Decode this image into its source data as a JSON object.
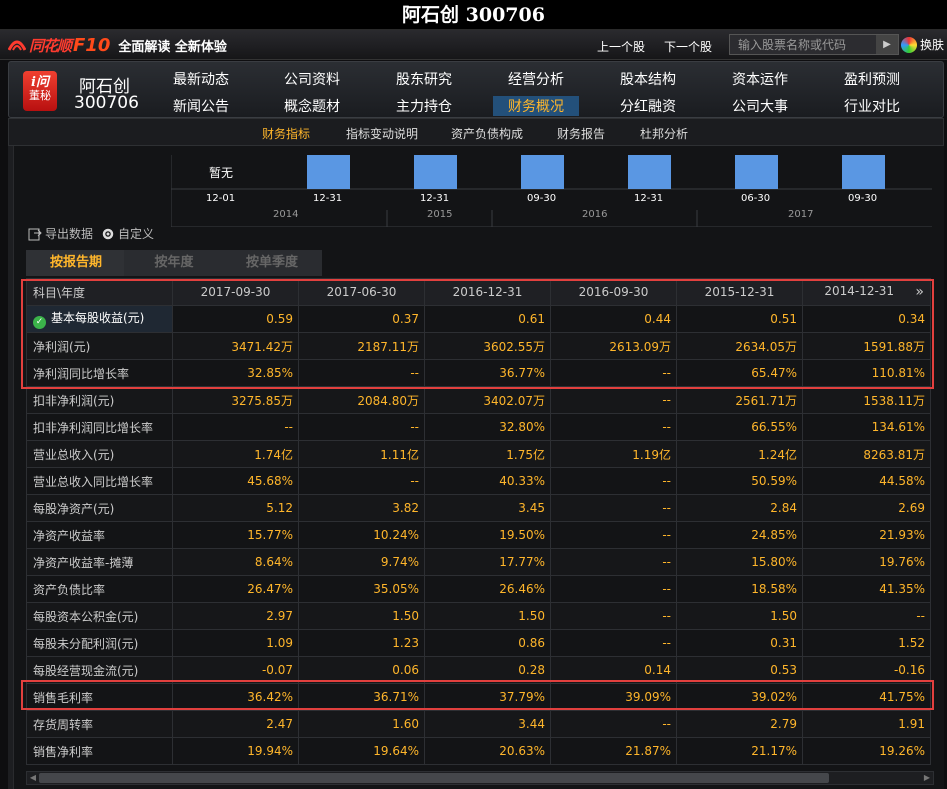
{
  "window_title": "阿石创 300706",
  "topbar": {
    "brand_name": "同花顺",
    "brand_f10": "F10",
    "slogan": "全面解读 全新体验",
    "prev_stock": "上一个股",
    "next_stock": "下一个股",
    "search_placeholder": "输入股票名称或代码",
    "skin": "换肤"
  },
  "header": {
    "app_icon_top": "i问",
    "app_icon_bottom": "董秘",
    "stock_name": "阿石创",
    "stock_code": "300706",
    "nav_row1": [
      "最新动态",
      "公司资料",
      "股东研究",
      "经营分析",
      "股本结构",
      "资本运作",
      "盈利预测"
    ],
    "nav_row2": [
      "新闻公告",
      "概念题材",
      "主力持仓",
      "财务概况",
      "分红融资",
      "公司大事",
      "行业对比"
    ],
    "active_nav": "财务概况"
  },
  "subnav": {
    "items": [
      "财务指标",
      "指标变动说明",
      "资产负债构成",
      "财务报告",
      "杜邦分析"
    ],
    "active": "财务指标"
  },
  "chart_data": {
    "type": "bar",
    "categories": [
      "12-01",
      "12-31",
      "12-31",
      "09-30",
      "12-31",
      "06-30",
      "09-30"
    ],
    "values": [
      null,
      1,
      1,
      1,
      1,
      1,
      1
    ],
    "no_data_label": "暂无",
    "years": [
      "2014",
      "2015",
      "2016",
      "2017"
    ]
  },
  "toolbar": {
    "export": "导出数据",
    "customize": "自定义"
  },
  "tabs": [
    "按报告期",
    "按年度",
    "按单季度"
  ],
  "active_tab": "按报告期",
  "table": {
    "header": [
      "科目\\年度",
      "2017-09-30",
      "2017-06-30",
      "2016-12-31",
      "2016-09-30",
      "2015-12-31",
      "2014-12-31"
    ],
    "more_icon": "»",
    "rows": [
      [
        "基本每股收益(元)",
        "0.59",
        "0.37",
        "0.61",
        "0.44",
        "0.51",
        "0.34"
      ],
      [
        "净利润(元)",
        "3471.42万",
        "2187.11万",
        "3602.55万",
        "2613.09万",
        "2634.05万",
        "1591.88万"
      ],
      [
        "净利润同比增长率",
        "32.85%",
        "--",
        "36.77%",
        "--",
        "65.47%",
        "110.81%"
      ],
      [
        "扣非净利润(元)",
        "3275.85万",
        "2084.80万",
        "3402.07万",
        "--",
        "2561.71万",
        "1538.11万"
      ],
      [
        "扣非净利润同比增长率",
        "--",
        "--",
        "32.80%",
        "--",
        "66.55%",
        "134.61%"
      ],
      [
        "营业总收入(元)",
        "1.74亿",
        "1.11亿",
        "1.75亿",
        "1.19亿",
        "1.24亿",
        "8263.81万"
      ],
      [
        "营业总收入同比增长率",
        "45.68%",
        "--",
        "40.33%",
        "--",
        "50.59%",
        "44.58%"
      ],
      [
        "每股净资产(元)",
        "5.12",
        "3.82",
        "3.45",
        "--",
        "2.84",
        "2.69"
      ],
      [
        "净资产收益率",
        "15.77%",
        "10.24%",
        "19.50%",
        "--",
        "24.85%",
        "21.93%"
      ],
      [
        "净资产收益率-摊薄",
        "8.64%",
        "9.74%",
        "17.77%",
        "--",
        "15.80%",
        "19.76%"
      ],
      [
        "资产负债比率",
        "26.47%",
        "35.05%",
        "26.46%",
        "--",
        "18.58%",
        "41.35%"
      ],
      [
        "每股资本公积金(元)",
        "2.97",
        "1.50",
        "1.50",
        "--",
        "1.50",
        "--"
      ],
      [
        "每股未分配利润(元)",
        "1.09",
        "1.23",
        "0.86",
        "--",
        "0.31",
        "1.52"
      ],
      [
        "每股经营现金流(元)",
        "-0.07",
        "0.06",
        "0.28",
        "0.14",
        "0.53",
        "-0.16"
      ],
      [
        "销售毛利率",
        "36.42%",
        "36.71%",
        "37.79%",
        "39.09%",
        "39.02%",
        "41.75%"
      ],
      [
        "存货周转率",
        "2.47",
        "1.60",
        "3.44",
        "--",
        "2.79",
        "1.91"
      ],
      [
        "销售净利率",
        "19.94%",
        "19.64%",
        "20.63%",
        "21.87%",
        "21.17%",
        "19.26%"
      ]
    ]
  },
  "colors": {
    "accent_orange": "#ffb62b",
    "highlight_red": "#e2403e",
    "bar_blue": "#5a97e3"
  }
}
